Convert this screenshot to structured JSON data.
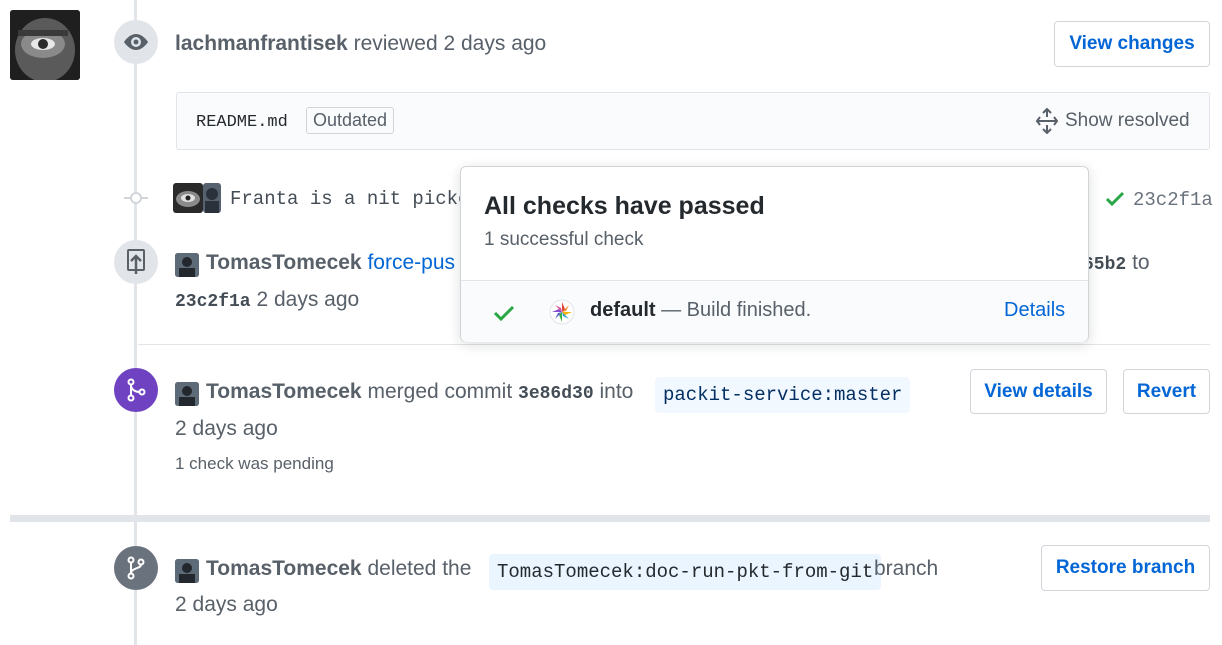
{
  "review": {
    "author": "lachmanfrantisek",
    "action": "reviewed",
    "time": "2 days ago",
    "view_changes_label": "View changes",
    "file": "README.md",
    "outdated_label": "Outdated",
    "show_resolved_label": "Show resolved"
  },
  "commit": {
    "message": "Franta is a nit picke",
    "sha": "23c2f1a"
  },
  "force_push": {
    "author": "TomasTomecek",
    "action": "force-pus",
    "from_fragment": "65b2",
    "to_label": "to",
    "to_sha": "23c2f1a",
    "time": "2 days ago"
  },
  "merge": {
    "author": "TomasTomecek",
    "action": "merged commit",
    "sha": "3e86d30",
    "into_label": "into",
    "target": "packit-service:master",
    "time": "2 days ago",
    "checks_note": "1 check was pending",
    "view_details_label": "View details",
    "revert_label": "Revert"
  },
  "branch_delete": {
    "author": "TomasTomecek",
    "action": "deleted the",
    "branch": "TomasTomecek:doc-run-pkt-from-git",
    "suffix": "branch",
    "time": "2 days ago",
    "restore_label": "Restore branch"
  },
  "popover": {
    "title": "All checks have passed",
    "subtitle": "1 successful check",
    "check_name": "default",
    "check_desc": "— Build finished.",
    "details_label": "Details"
  },
  "colors": {
    "link": "#0366d6",
    "success": "#28a745",
    "merged": "#6f42c1"
  }
}
